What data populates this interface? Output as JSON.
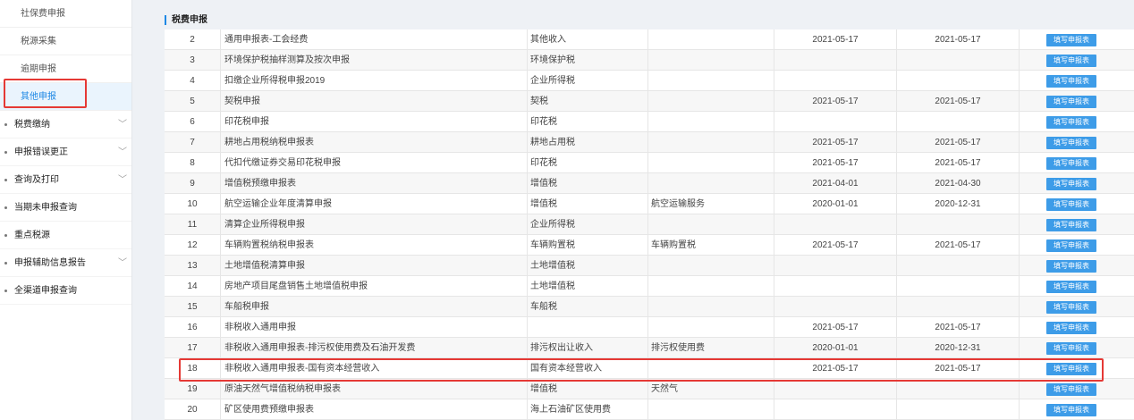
{
  "sidebar": {
    "sub_items": [
      {
        "label": "社保费申报"
      },
      {
        "label": "税源采集"
      },
      {
        "label": "逾期申报"
      },
      {
        "label": "其他申报"
      }
    ],
    "menu_items": [
      {
        "label": "税费缴纳",
        "has_chevron": true
      },
      {
        "label": "申报错误更正",
        "has_chevron": true
      },
      {
        "label": "查询及打印",
        "has_chevron": true
      },
      {
        "label": "当期未申报查询",
        "has_chevron": false
      },
      {
        "label": "重点税源",
        "has_chevron": false
      },
      {
        "label": "申报辅助信息报告",
        "has_chevron": true
      },
      {
        "label": "全渠道申报查询",
        "has_chevron": false
      }
    ]
  },
  "main": {
    "section_title": "税费申报",
    "fill_label": "填写申报表",
    "rows": [
      {
        "no": "2",
        "name": "通用申报表-工会经费",
        "type": "其他收入",
        "sub": "",
        "start": "2021-05-17",
        "end": "2021-05-17"
      },
      {
        "no": "3",
        "name": "环境保护税抽样测算及按次申报",
        "type": "环境保护税",
        "sub": "",
        "start": "",
        "end": ""
      },
      {
        "no": "4",
        "name": "扣缴企业所得税申报2019",
        "type": "企业所得税",
        "sub": "",
        "start": "",
        "end": ""
      },
      {
        "no": "5",
        "name": "契税申报",
        "type": "契税",
        "sub": "",
        "start": "2021-05-17",
        "end": "2021-05-17"
      },
      {
        "no": "6",
        "name": "印花税申报",
        "type": "印花税",
        "sub": "",
        "start": "",
        "end": ""
      },
      {
        "no": "7",
        "name": "耕地占用税纳税申报表",
        "type": "耕地占用税",
        "sub": "",
        "start": "2021-05-17",
        "end": "2021-05-17"
      },
      {
        "no": "8",
        "name": "代扣代缴证券交易印花税申报",
        "type": "印花税",
        "sub": "",
        "start": "2021-05-17",
        "end": "2021-05-17"
      },
      {
        "no": "9",
        "name": "增值税预缴申报表",
        "type": "增值税",
        "sub": "",
        "start": "2021-04-01",
        "end": "2021-04-30"
      },
      {
        "no": "10",
        "name": "航空运输企业年度清算申报",
        "type": "增值税",
        "sub": "航空运输服务",
        "start": "2020-01-01",
        "end": "2020-12-31"
      },
      {
        "no": "11",
        "name": "清算企业所得税申报",
        "type": "企业所得税",
        "sub": "",
        "start": "",
        "end": ""
      },
      {
        "no": "12",
        "name": "车辆购置税纳税申报表",
        "type": "车辆购置税",
        "sub": "车辆购置税",
        "start": "2021-05-17",
        "end": "2021-05-17"
      },
      {
        "no": "13",
        "name": "土地增值税清算申报",
        "type": "土地增值税",
        "sub": "",
        "start": "",
        "end": ""
      },
      {
        "no": "14",
        "name": "房地产项目尾盘销售土地增值税申报",
        "type": "土地增值税",
        "sub": "",
        "start": "",
        "end": ""
      },
      {
        "no": "15",
        "name": "车船税申报",
        "type": "车船税",
        "sub": "",
        "start": "",
        "end": ""
      },
      {
        "no": "16",
        "name": "非税收入通用申报",
        "type": "",
        "sub": "",
        "start": "2021-05-17",
        "end": "2021-05-17"
      },
      {
        "no": "17",
        "name": "非税收入通用申报表-排污权使用费及石油开发费",
        "type": "排污权出让收入",
        "sub": "排污权使用费",
        "start": "2020-01-01",
        "end": "2020-12-31"
      },
      {
        "no": "18",
        "name": "非税收入通用申报表-国有资本经营收入",
        "type": "国有资本经营收入",
        "sub": "",
        "start": "2021-05-17",
        "end": "2021-05-17"
      },
      {
        "no": "19",
        "name": "原油天然气增值税纳税申报表",
        "type": "增值税",
        "sub": "天然气",
        "start": "",
        "end": ""
      },
      {
        "no": "20",
        "name": "矿区使用费预缴申报表",
        "type": "海上石油矿区使用费",
        "sub": "",
        "start": "",
        "end": ""
      }
    ]
  }
}
